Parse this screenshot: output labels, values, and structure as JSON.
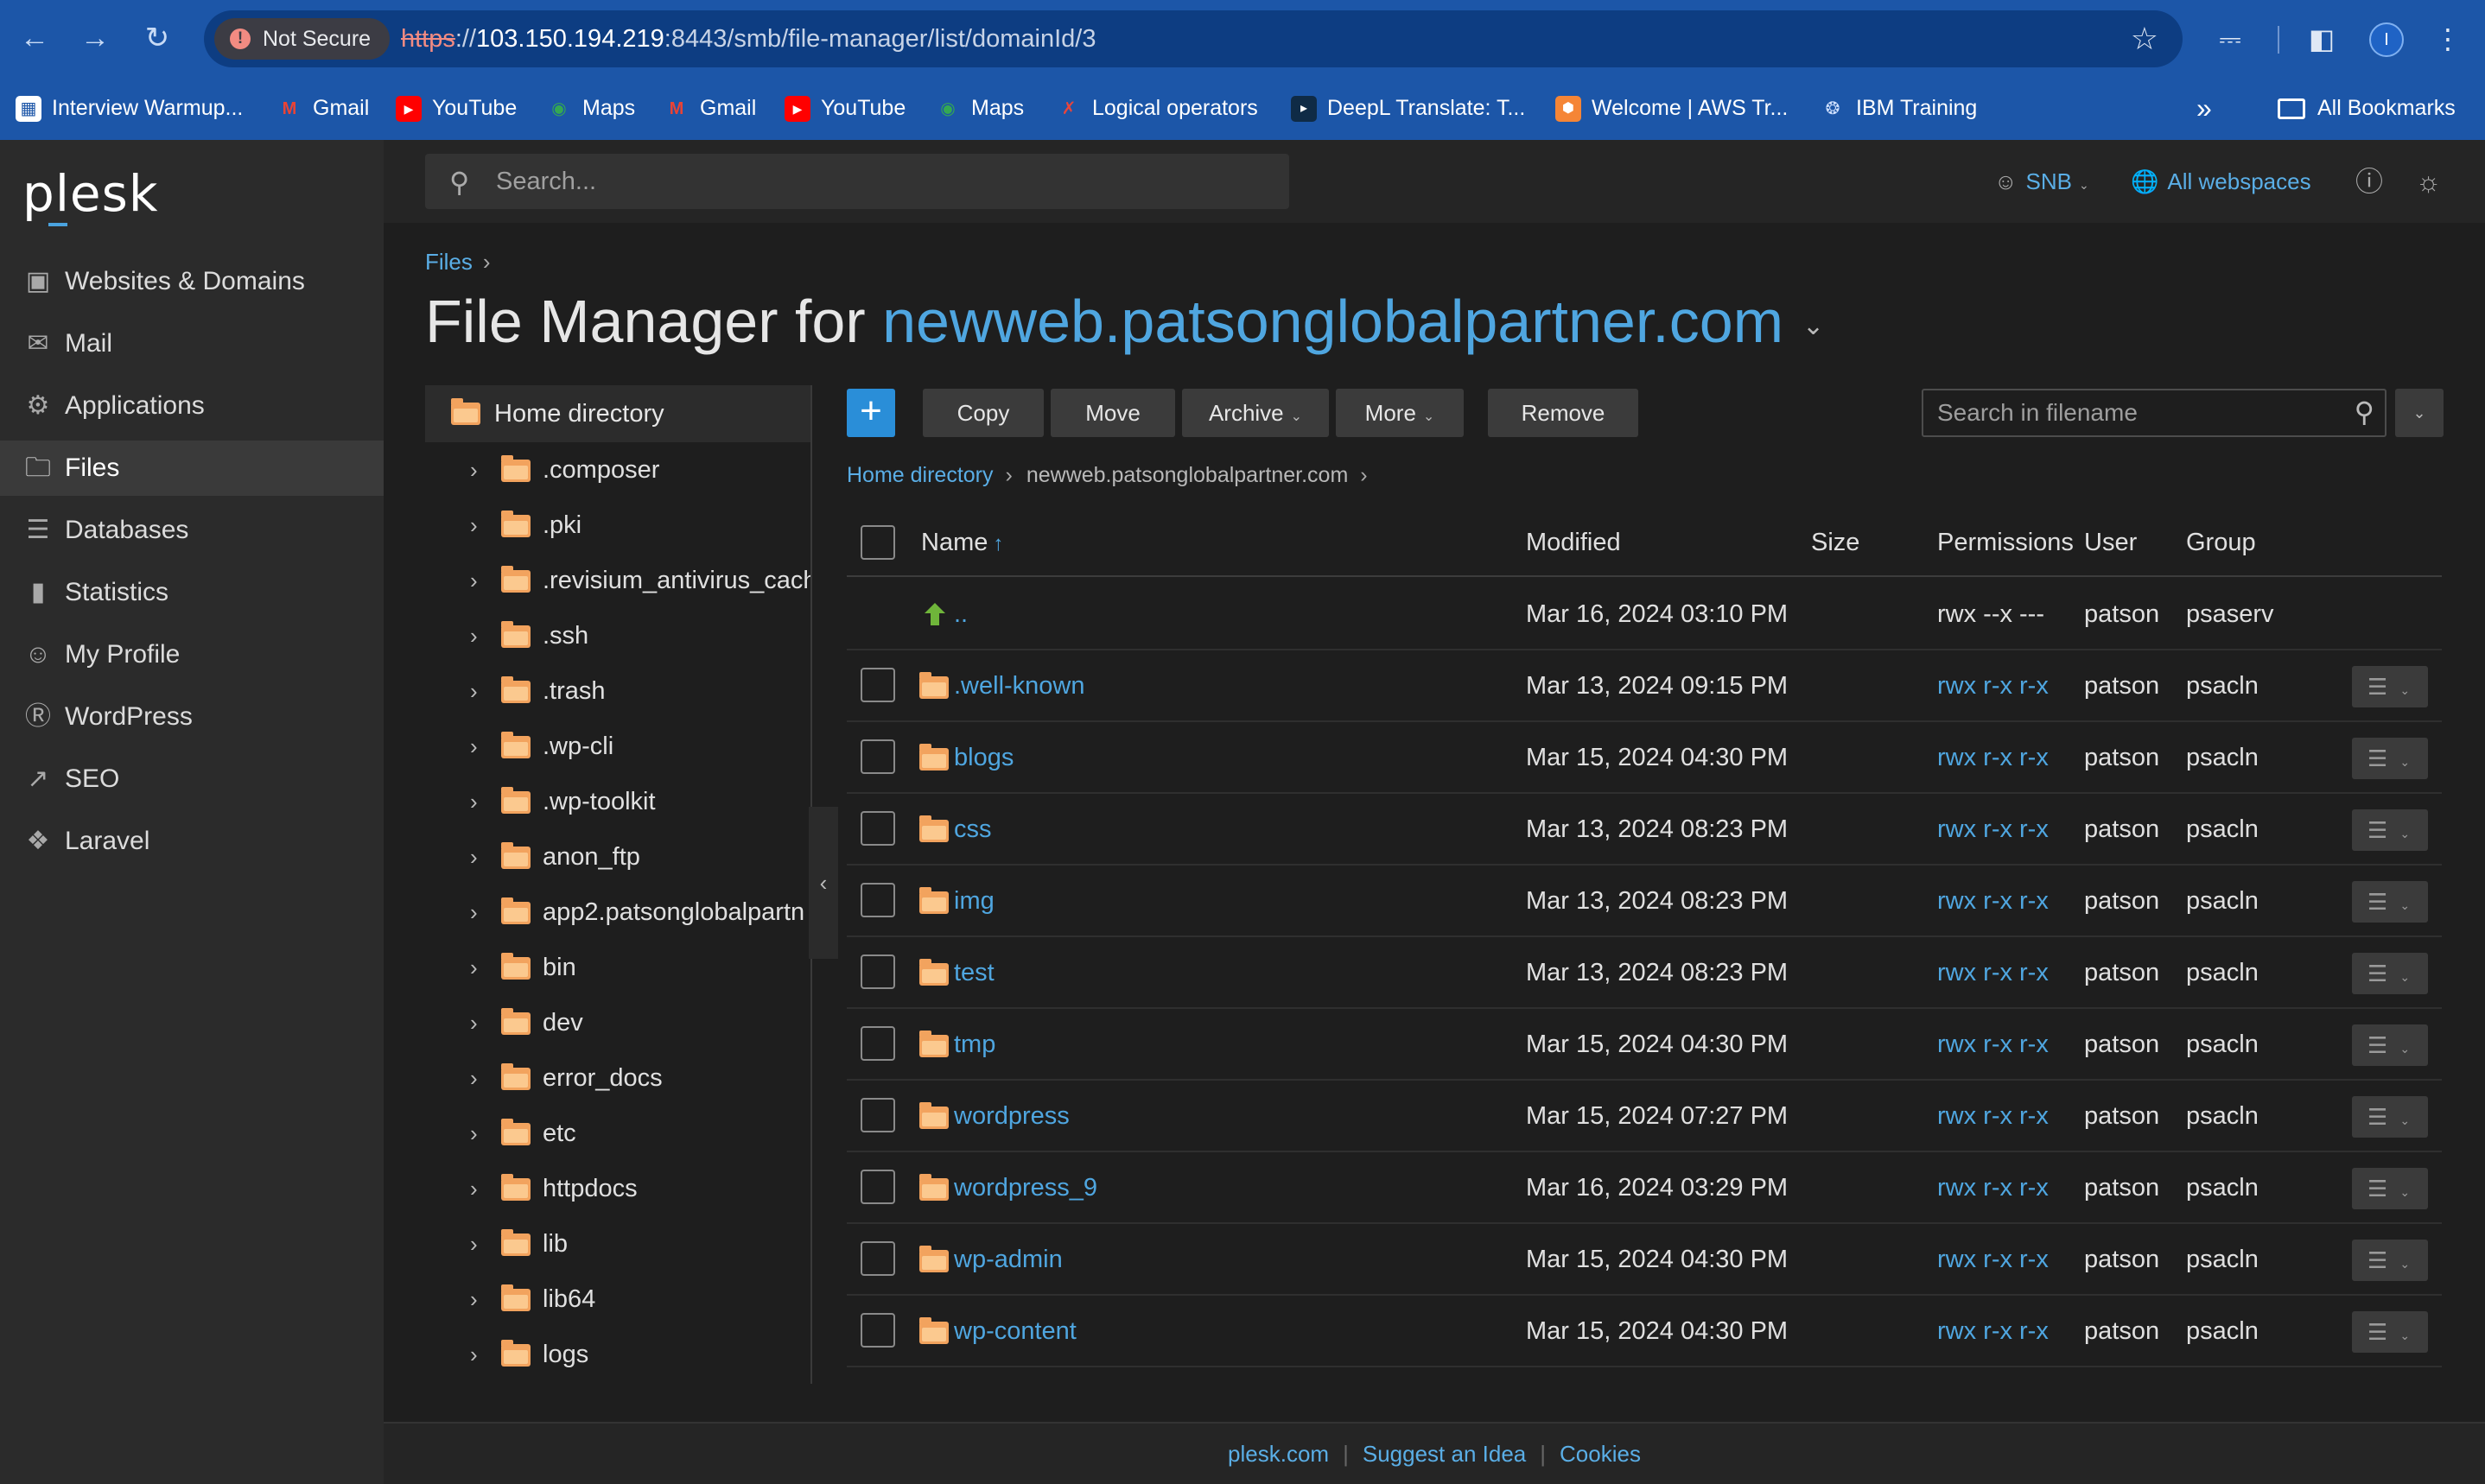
{
  "browser": {
    "security_label": "Not Secure",
    "url_scheme": "https",
    "url_host": "103.150.194.219",
    "url_rest": ":8443/smb/file-manager/list/domainId/3",
    "bookmarks": [
      {
        "label": "Interview Warmup...",
        "icon": "interview-warmup-icon",
        "color": "#ffffff"
      },
      {
        "label": "Gmail",
        "icon": "gmail-icon",
        "color": "#ea4335"
      },
      {
        "label": "YouTube",
        "icon": "youtube-icon",
        "color": "#ff0000"
      },
      {
        "label": "Maps",
        "icon": "maps-icon",
        "color": "#34a853"
      },
      {
        "label": "Gmail",
        "icon": "gmail-icon",
        "color": "#ea4335"
      },
      {
        "label": "YouTube",
        "icon": "youtube-icon",
        "color": "#ff0000"
      },
      {
        "label": "Maps",
        "icon": "maps-icon",
        "color": "#34a853"
      },
      {
        "label": "Logical operators",
        "icon": "logical-operators-icon",
        "color": "#e8453c"
      },
      {
        "label": "DeepL Translate: T...",
        "icon": "deepl-icon",
        "color": "#0f2b46"
      },
      {
        "label": "Welcome | AWS Tr...",
        "icon": "aws-icon",
        "color": "#f58536"
      },
      {
        "label": "IBM Training",
        "icon": "ibm-icon",
        "color": "#1c56a8"
      }
    ],
    "more_bookmarks": "»",
    "all_bookmarks": "All Bookmarks",
    "profile_initial": "I"
  },
  "sidebar": {
    "logo": "plesk",
    "items": [
      {
        "label": "Websites & Domains",
        "icon": "monitor-icon"
      },
      {
        "label": "Mail",
        "icon": "mail-icon"
      },
      {
        "label": "Applications",
        "icon": "gear-icon"
      },
      {
        "label": "Files",
        "icon": "files-icon"
      },
      {
        "label": "Databases",
        "icon": "database-icon"
      },
      {
        "label": "Statistics",
        "icon": "statistics-icon"
      },
      {
        "label": "My Profile",
        "icon": "profile-icon"
      },
      {
        "label": "WordPress",
        "icon": "wordpress-icon"
      },
      {
        "label": "SEO",
        "icon": "seo-icon"
      },
      {
        "label": "Laravel",
        "icon": "laravel-icon"
      }
    ],
    "active_index": 3
  },
  "topbar": {
    "search_placeholder": "Search...",
    "user": "SNB",
    "webspaces": "All webspaces"
  },
  "page": {
    "breadcrumb": "Files",
    "title_prefix": "File Manager for",
    "domain": "newweb.patsonglobalpartner.com"
  },
  "tree": {
    "root": "Home directory",
    "items": [
      ".composer",
      ".pki",
      ".revisium_antivirus_cach",
      ".ssh",
      ".trash",
      ".wp-cli",
      ".wp-toolkit",
      "anon_ftp",
      "app2.patsonglobalpartn",
      "bin",
      "dev",
      "error_docs",
      "etc",
      "httpdocs",
      "lib",
      "lib64",
      "logs"
    ]
  },
  "toolbar": {
    "add_label": "+",
    "copy": "Copy",
    "move": "Move",
    "archive": "Archive",
    "more": "More",
    "remove": "Remove",
    "search_placeholder": "Search in filename"
  },
  "path": {
    "home": "Home directory",
    "current": "newweb.patsonglobalpartner.com"
  },
  "table": {
    "columns": {
      "name": "Name",
      "modified": "Modified",
      "size": "Size",
      "permissions": "Permissions",
      "user": "User",
      "group": "Group"
    },
    "parent_row": {
      "name": "..",
      "modified": "Mar 16, 2024 03:10 PM",
      "permissions": "rwx --x ---",
      "user": "patson",
      "group": "psaserv"
    },
    "rows": [
      {
        "name": ".well-known",
        "modified": "Mar 13, 2024 09:15 PM",
        "size": "",
        "permissions": "rwx r-x r-x",
        "user": "patson",
        "group": "psacln"
      },
      {
        "name": "blogs",
        "modified": "Mar 15, 2024 04:30 PM",
        "size": "",
        "permissions": "rwx r-x r-x",
        "user": "patson",
        "group": "psacln"
      },
      {
        "name": "css",
        "modified": "Mar 13, 2024 08:23 PM",
        "size": "",
        "permissions": "rwx r-x r-x",
        "user": "patson",
        "group": "psacln"
      },
      {
        "name": "img",
        "modified": "Mar 13, 2024 08:23 PM",
        "size": "",
        "permissions": "rwx r-x r-x",
        "user": "patson",
        "group": "psacln"
      },
      {
        "name": "test",
        "modified": "Mar 13, 2024 08:23 PM",
        "size": "",
        "permissions": "rwx r-x r-x",
        "user": "patson",
        "group": "psacln"
      },
      {
        "name": "tmp",
        "modified": "Mar 15, 2024 04:30 PM",
        "size": "",
        "permissions": "rwx r-x r-x",
        "user": "patson",
        "group": "psacln"
      },
      {
        "name": "wordpress",
        "modified": "Mar 15, 2024 07:27 PM",
        "size": "",
        "permissions": "rwx r-x r-x",
        "user": "patson",
        "group": "psacln"
      },
      {
        "name": "wordpress_9",
        "modified": "Mar 16, 2024 03:29 PM",
        "size": "",
        "permissions": "rwx r-x r-x",
        "user": "patson",
        "group": "psacln"
      },
      {
        "name": "wp-admin",
        "modified": "Mar 15, 2024 04:30 PM",
        "size": "",
        "permissions": "rwx r-x r-x",
        "user": "patson",
        "group": "psacln"
      },
      {
        "name": "wp-content",
        "modified": "Mar 15, 2024 04:30 PM",
        "size": "",
        "permissions": "rwx r-x r-x",
        "user": "patson",
        "group": "psacln"
      }
    ]
  },
  "footer": {
    "links": [
      "plesk.com",
      "Suggest an Idea",
      "Cookies"
    ]
  },
  "colors": {
    "accent": "#4fa6e0",
    "folder": "#f2a35e",
    "chrome_blue": "#1c56a8",
    "background": "#1e1e1e"
  }
}
